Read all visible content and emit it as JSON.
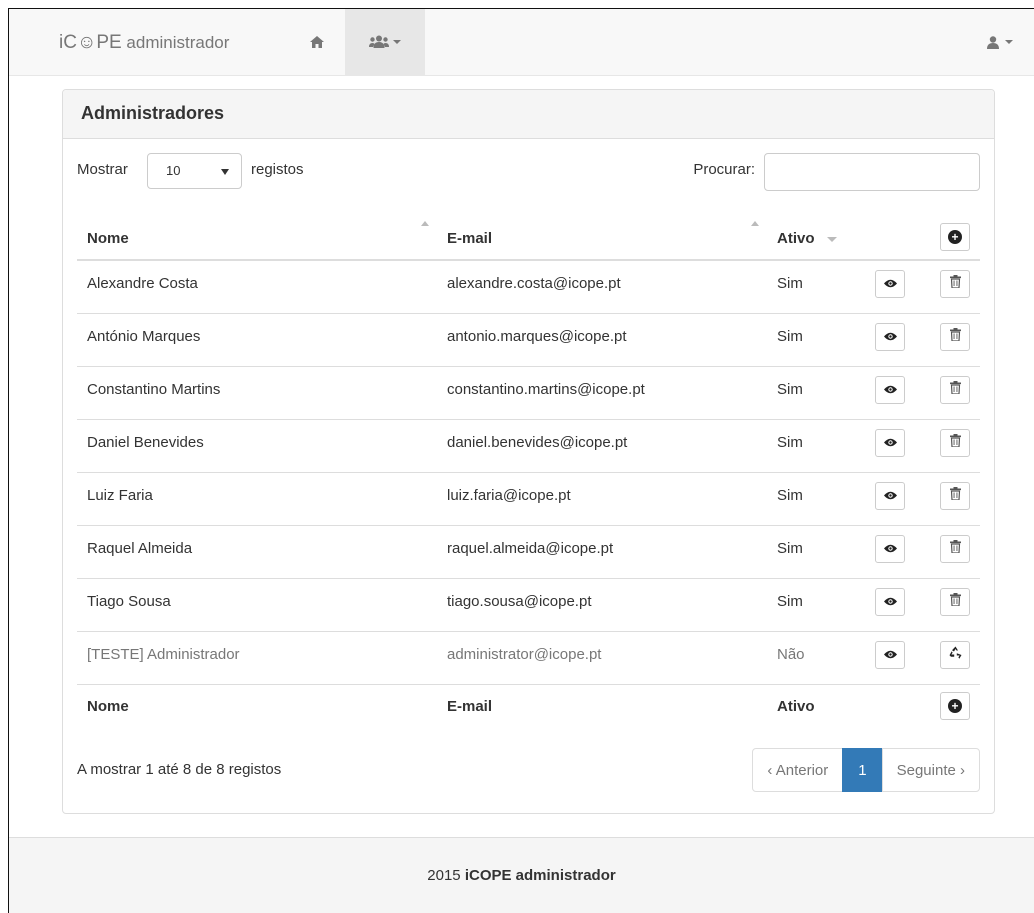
{
  "navbar": {
    "brand_prefix": "iC☺PE",
    "brand_suffix": " administrador"
  },
  "panel": {
    "title": "Administradores"
  },
  "controls": {
    "show_label": "Mostrar",
    "page_size": "10",
    "records_label": "registos",
    "search_label": "Procurar:",
    "search_value": ""
  },
  "table": {
    "headers": {
      "name": "Nome",
      "email": "E-mail",
      "active": "Ativo"
    },
    "rows": [
      {
        "name": "Alexandre Costa",
        "email": "alexandre.costa@icope.pt",
        "active": "Sim"
      },
      {
        "name": "António Marques",
        "email": "antonio.marques@icope.pt",
        "active": "Sim"
      },
      {
        "name": "Constantino Martins",
        "email": "constantino.martins@icope.pt",
        "active": "Sim"
      },
      {
        "name": "Daniel Benevides",
        "email": "daniel.benevides@icope.pt",
        "active": "Sim"
      },
      {
        "name": "Luiz Faria",
        "email": "luiz.faria@icope.pt",
        "active": "Sim"
      },
      {
        "name": "Raquel Almeida",
        "email": "raquel.almeida@icope.pt",
        "active": "Sim"
      },
      {
        "name": "Tiago Sousa",
        "email": "tiago.sousa@icope.pt",
        "active": "Sim"
      },
      {
        "name": "[TESTE] Administrador",
        "email": "administrator@icope.pt",
        "active": "Não"
      }
    ]
  },
  "info": "A mostrar 1 até 8 de 8 registos",
  "pagination": {
    "prev": "‹ Anterior",
    "current": "1",
    "next": "Seguinte ›"
  },
  "footer": {
    "year": "2015 ",
    "brand": "iCOPE administrador"
  },
  "colors": {
    "accent": "#337ab7",
    "navbar_bg": "#f8f8f8"
  },
  "icons": [
    "home-icon",
    "users-icon",
    "user-icon",
    "plus-circle-icon",
    "eye-icon",
    "trash-icon",
    "recycle-icon"
  ]
}
